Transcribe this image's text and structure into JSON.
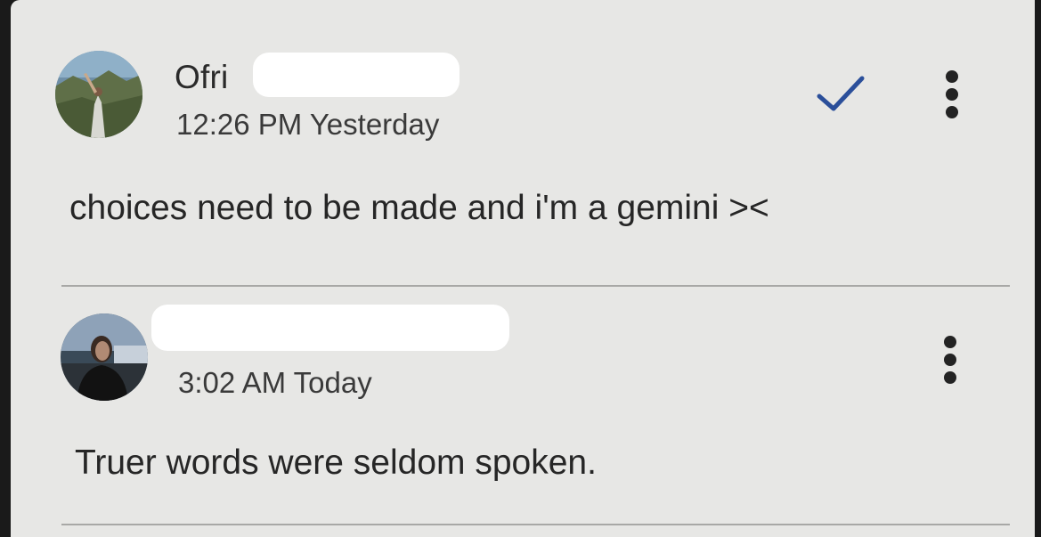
{
  "comments": [
    {
      "author": "Ofri",
      "timestamp": "12:26 PM Yesterday",
      "text": "choices need to be made and i'm a gemini ><",
      "resolved_icon": "checkmark-icon",
      "menu_icon": "more-vert-icon"
    },
    {
      "author": "",
      "timestamp": "3:02 AM Today",
      "text": "Truer words were seldom spoken.",
      "menu_icon": "more-vert-icon"
    }
  ],
  "colors": {
    "background": "#e7e7e5",
    "checkmark": "#2b4f9a",
    "text": "#262626",
    "divider": "#a8a8a6"
  }
}
